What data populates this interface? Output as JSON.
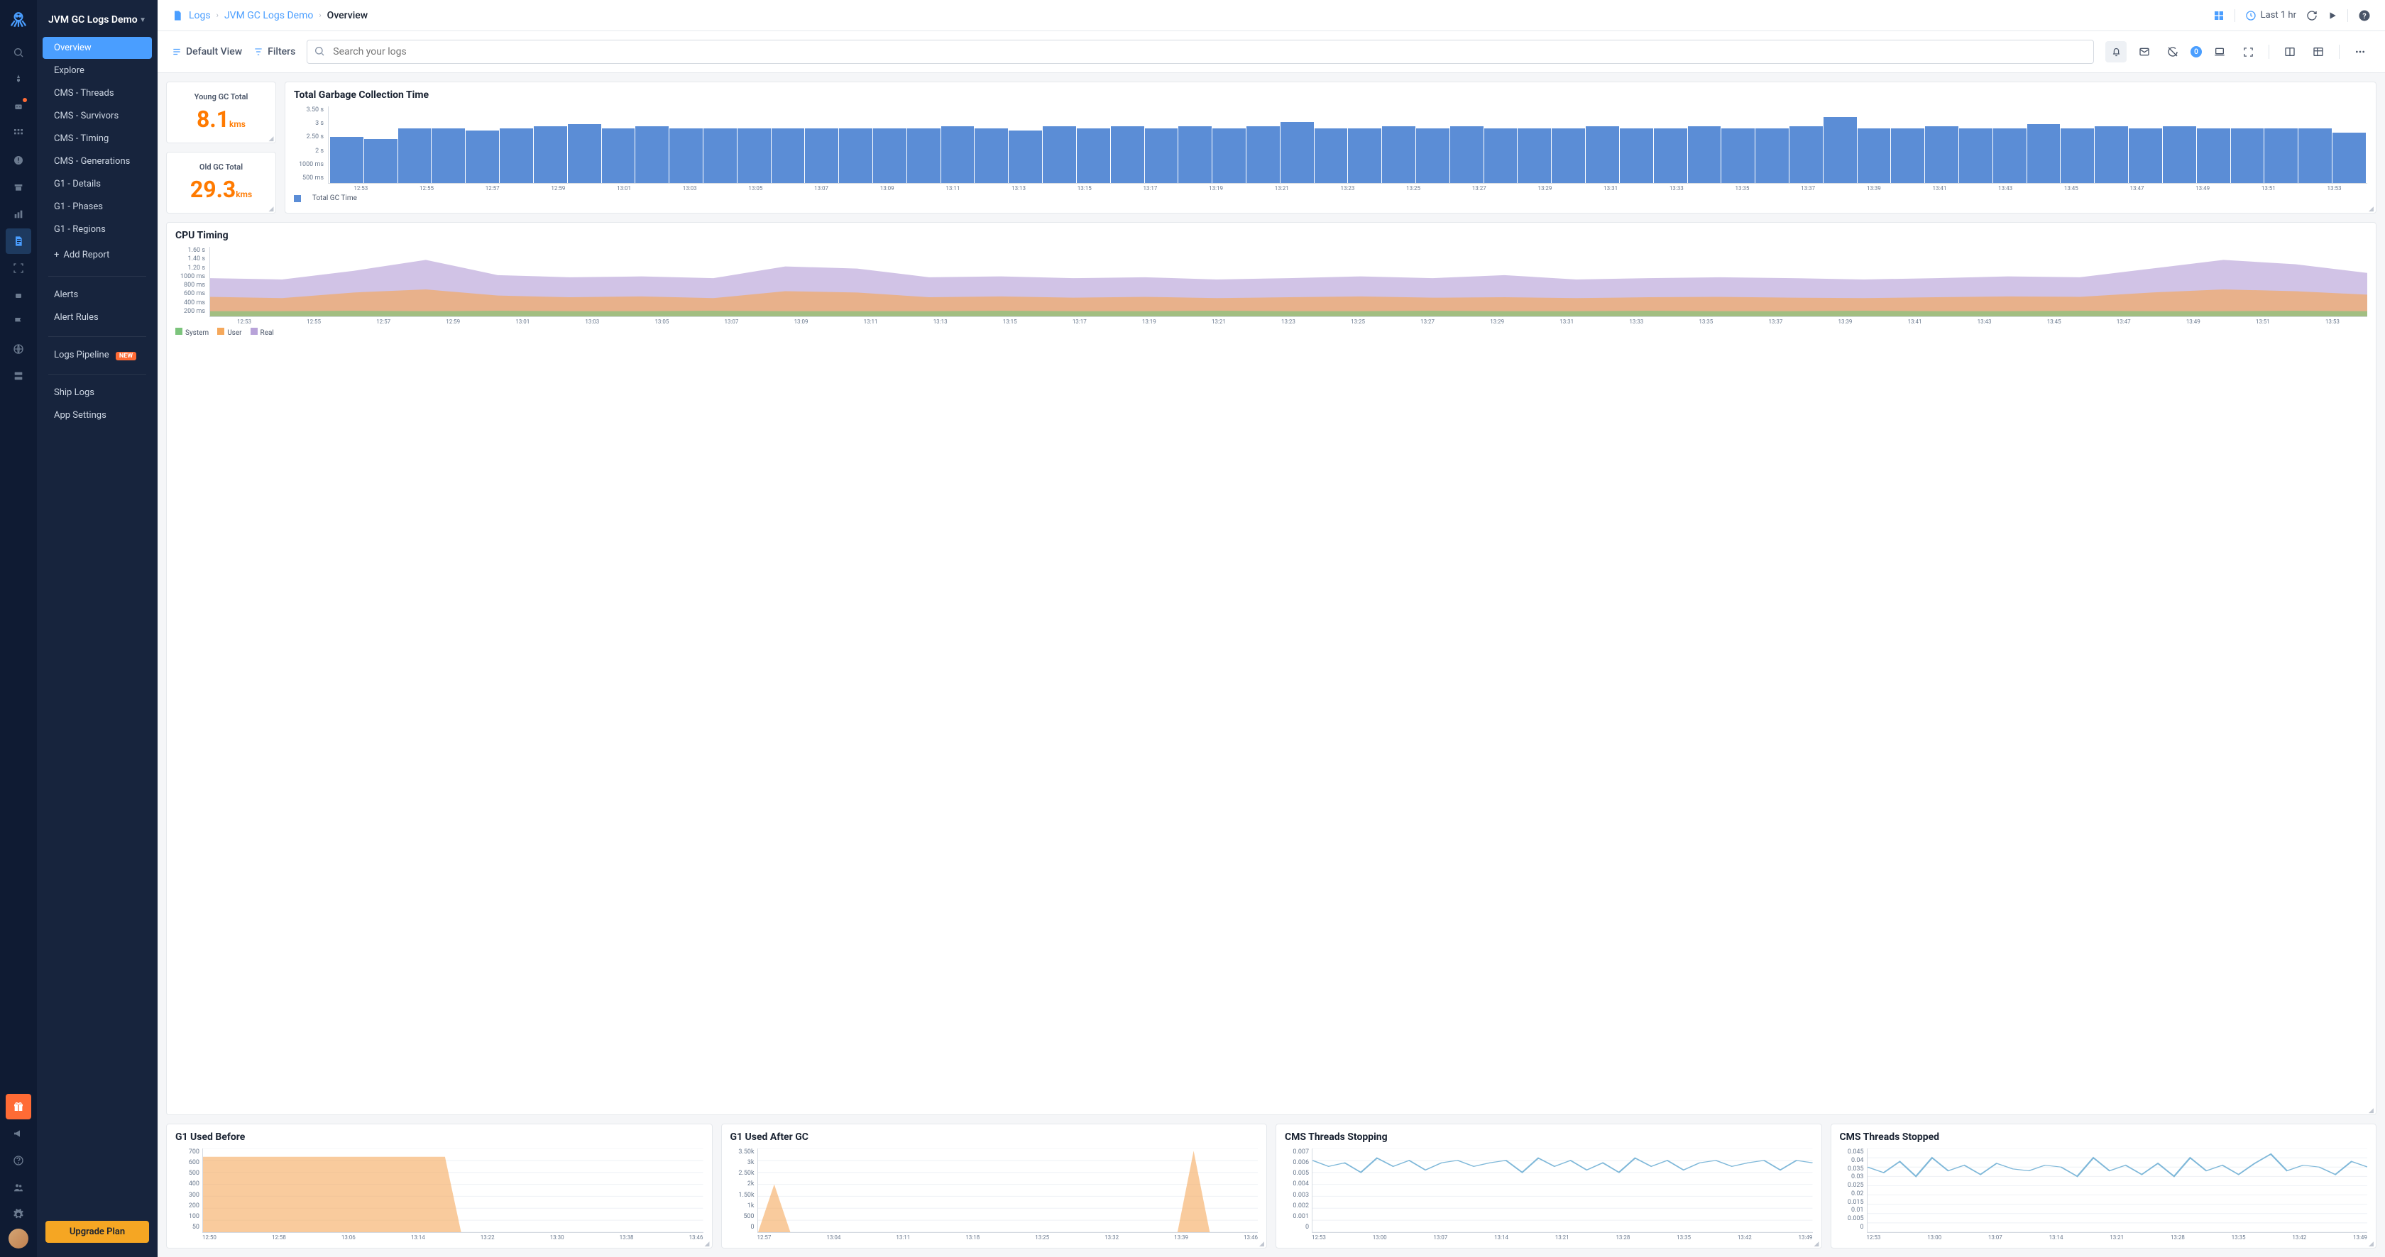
{
  "app_title": "JVM GC Logs Demo",
  "breadcrumb": {
    "root": "Logs",
    "mid": "JVM GC Logs Demo",
    "current": "Overview"
  },
  "timerange": "Last 1 hr",
  "sidebar": {
    "items": [
      {
        "label": "Overview",
        "active": true
      },
      {
        "label": "Explore"
      },
      {
        "label": "CMS - Threads"
      },
      {
        "label": "CMS - Survivors"
      },
      {
        "label": "CMS - Timing"
      },
      {
        "label": "CMS - Generations"
      },
      {
        "label": "G1 - Details"
      },
      {
        "label": "G1 - Phases"
      },
      {
        "label": "G1 - Regions"
      }
    ],
    "add_report": "Add Report",
    "alerts": "Alerts",
    "alert_rules": "Alert Rules",
    "pipelines": "Logs Pipeline",
    "pipelines_badge": "NEW",
    "ship": "Ship Logs",
    "settings": "App Settings",
    "upgrade": "Upgrade Plan"
  },
  "toolbar": {
    "default_view": "Default View",
    "filters": "Filters",
    "search_placeholder": "Search your logs",
    "notif_count": "0"
  },
  "metrics": {
    "young": {
      "title": "Young GC Total",
      "value": "8.1",
      "unit": "kms"
    },
    "old": {
      "title": "Old GC Total",
      "value": "29.3",
      "unit": "kms"
    }
  },
  "chart_data": [
    {
      "id": "gc_time",
      "type": "bar",
      "title": "Total Garbage Collection Time",
      "ylabel": "",
      "y_ticks": [
        "3.50 s",
        "3 s",
        "2.50 s",
        "2 s",
        "1000 ms",
        "500 ms"
      ],
      "legend": [
        {
          "name": "Total GC Time",
          "color": "#5b8dd6"
        }
      ],
      "categories": [
        "12:53",
        "12:55",
        "12:57",
        "12:59",
        "13:01",
        "13:03",
        "13:05",
        "13:07",
        "13:09",
        "13:11",
        "13:13",
        "13:15",
        "13:17",
        "13:19",
        "13:21",
        "13:23",
        "13:25",
        "13:27",
        "13:29",
        "13:31",
        "13:33",
        "13:35",
        "13:37",
        "13:39",
        "13:41",
        "13:43",
        "13:45",
        "13:47",
        "13:49",
        "13:51",
        "13:53"
      ],
      "values": [
        2.1,
        2.0,
        2.5,
        2.5,
        2.4,
        2.5,
        2.6,
        2.7,
        2.5,
        2.6,
        2.5,
        2.5,
        2.5,
        2.5,
        2.5,
        2.5,
        2.5,
        2.5,
        2.6,
        2.5,
        2.4,
        2.6,
        2.5,
        2.6,
        2.5,
        2.6,
        2.5,
        2.6,
        2.8,
        2.5,
        2.5,
        2.6,
        2.5,
        2.6,
        2.5,
        2.5,
        2.5,
        2.6,
        2.5,
        2.5,
        2.6,
        2.5,
        2.5,
        2.6,
        3.0,
        2.5,
        2.5,
        2.6,
        2.5,
        2.5,
        2.7,
        2.5,
        2.6,
        2.5,
        2.6,
        2.5,
        2.5,
        2.5,
        2.5,
        2.3
      ],
      "ylim": [
        0,
        3.5
      ]
    },
    {
      "id": "cpu_timing",
      "type": "area",
      "title": "CPU Timing",
      "y_ticks": [
        "1.60 s",
        "1.40 s",
        "1.20 s",
        "1000 ms",
        "800 ms",
        "600 ms",
        "400 ms",
        "200 ms"
      ],
      "x_ticks": [
        "12:53",
        "12:55",
        "12:57",
        "12:59",
        "13:01",
        "13:03",
        "13:05",
        "13:07",
        "13:09",
        "13:11",
        "13:13",
        "13:15",
        "13:17",
        "13:19",
        "13:21",
        "13:23",
        "13:25",
        "13:27",
        "13:29",
        "13:31",
        "13:33",
        "13:35",
        "13:37",
        "13:39",
        "13:41",
        "13:43",
        "13:45",
        "13:47",
        "13:49",
        "13:51",
        "13:53"
      ],
      "series": [
        {
          "name": "System",
          "color": "#7cc47c",
          "values": [
            0.12,
            0.12,
            0.13,
            0.12,
            0.13,
            0.12,
            0.12,
            0.13,
            0.12,
            0.12,
            0.12,
            0.13,
            0.12,
            0.12,
            0.13,
            0.12,
            0.12,
            0.13,
            0.12,
            0.12,
            0.13,
            0.12,
            0.12,
            0.13,
            0.12,
            0.12,
            0.13,
            0.12,
            0.12,
            0.13,
            0.12
          ]
        },
        {
          "name": "User",
          "color": "#f5a85b",
          "values": [
            0.45,
            0.42,
            0.55,
            0.62,
            0.48,
            0.44,
            0.46,
            0.42,
            0.58,
            0.55,
            0.44,
            0.46,
            0.43,
            0.45,
            0.42,
            0.44,
            0.46,
            0.43,
            0.44,
            0.42,
            0.44,
            0.45,
            0.43,
            0.42,
            0.44,
            0.46,
            0.45,
            0.55,
            0.62,
            0.58,
            0.5
          ]
        },
        {
          "name": "Real",
          "color": "#b8a3d9",
          "values": [
            0.88,
            0.85,
            1.05,
            1.3,
            0.95,
            0.9,
            0.92,
            0.88,
            1.15,
            1.1,
            0.9,
            0.92,
            0.88,
            0.9,
            0.85,
            0.88,
            0.92,
            0.88,
            0.95,
            0.85,
            0.88,
            0.9,
            0.88,
            0.85,
            0.88,
            0.92,
            0.9,
            1.1,
            1.3,
            1.2,
            1.0
          ]
        }
      ],
      "ylim": [
        0,
        1.6
      ]
    },
    {
      "id": "g1_before",
      "type": "area",
      "title": "G1 Used Before",
      "y_ticks": [
        "700",
        "600",
        "500",
        "400",
        "300",
        "200",
        "100",
        "50"
      ],
      "x_ticks": [
        "12:50",
        "12:58",
        "13:06",
        "13:14",
        "13:22",
        "13:30",
        "13:38",
        "13:46"
      ],
      "series": [
        {
          "name": "",
          "color": "#f5a85b",
          "values": [
            630,
            630,
            630,
            630,
            630,
            630,
            630,
            630,
            630,
            630,
            630,
            630,
            630,
            630,
            630,
            630,
            0,
            0,
            0,
            0,
            0,
            0,
            0,
            0,
            0,
            0,
            0,
            0,
            0,
            0,
            0,
            0
          ]
        }
      ],
      "ylim": [
        0,
        700
      ]
    },
    {
      "id": "g1_after",
      "type": "area",
      "title": "G1 Used After GC",
      "y_ticks": [
        "3.50k",
        "3k",
        "2.50k",
        "2k",
        "1.50k",
        "1k",
        "500",
        "0"
      ],
      "x_ticks": [
        "12:57",
        "13:04",
        "13:11",
        "13:18",
        "13:25",
        "13:32",
        "13:39",
        "13:46"
      ],
      "series": [
        {
          "name": "",
          "color": "#f5a85b",
          "values": [
            0,
            2000,
            0,
            0,
            0,
            0,
            0,
            0,
            0,
            0,
            0,
            0,
            0,
            0,
            0,
            0,
            0,
            0,
            0,
            0,
            0,
            0,
            0,
            0,
            0,
            0,
            0,
            3400,
            0,
            0,
            0,
            0
          ]
        }
      ],
      "ylim": [
        0,
        3500
      ]
    },
    {
      "id": "cms_stopping",
      "type": "line",
      "title": "CMS Threads Stopping",
      "y_ticks": [
        "0.007",
        "0.006",
        "0.005",
        "0.004",
        "0.003",
        "0.002",
        "0.001",
        "0"
      ],
      "x_ticks": [
        "12:53",
        "13:00",
        "13:07",
        "13:14",
        "13:21",
        "13:28",
        "13:35",
        "13:42",
        "13:49"
      ],
      "series": [
        {
          "name": "",
          "color": "#7fb8d9",
          "values": [
            0.006,
            0.0055,
            0.0058,
            0.005,
            0.0062,
            0.0055,
            0.006,
            0.0052,
            0.0058,
            0.006,
            0.0055,
            0.0058,
            0.006,
            0.005,
            0.0062,
            0.0055,
            0.006,
            0.0052,
            0.0058,
            0.005,
            0.0062,
            0.0055,
            0.006,
            0.0052,
            0.0058,
            0.006,
            0.0055,
            0.0058,
            0.006,
            0.0052,
            0.006,
            0.0058
          ]
        }
      ],
      "ylim": [
        0,
        0.007
      ]
    },
    {
      "id": "cms_stopped",
      "type": "line",
      "title": "CMS Threads Stopped",
      "y_ticks": [
        "0.045",
        "0.04",
        "0.035",
        "0.03",
        "0.025",
        "0.02",
        "0.015",
        "0.01",
        "0.005",
        "0"
      ],
      "x_ticks": [
        "12:53",
        "13:00",
        "13:07",
        "13:14",
        "13:21",
        "13:28",
        "13:35",
        "13:42",
        "13:49"
      ],
      "series": [
        {
          "name": "",
          "color": "#7fb8d9",
          "values": [
            0.035,
            0.032,
            0.038,
            0.03,
            0.04,
            0.033,
            0.036,
            0.031,
            0.037,
            0.034,
            0.033,
            0.036,
            0.035,
            0.03,
            0.04,
            0.033,
            0.036,
            0.031,
            0.037,
            0.03,
            0.04,
            0.033,
            0.036,
            0.031,
            0.037,
            0.042,
            0.033,
            0.036,
            0.035,
            0.031,
            0.038,
            0.035
          ]
        }
      ],
      "ylim": [
        0,
        0.045
      ]
    }
  ]
}
